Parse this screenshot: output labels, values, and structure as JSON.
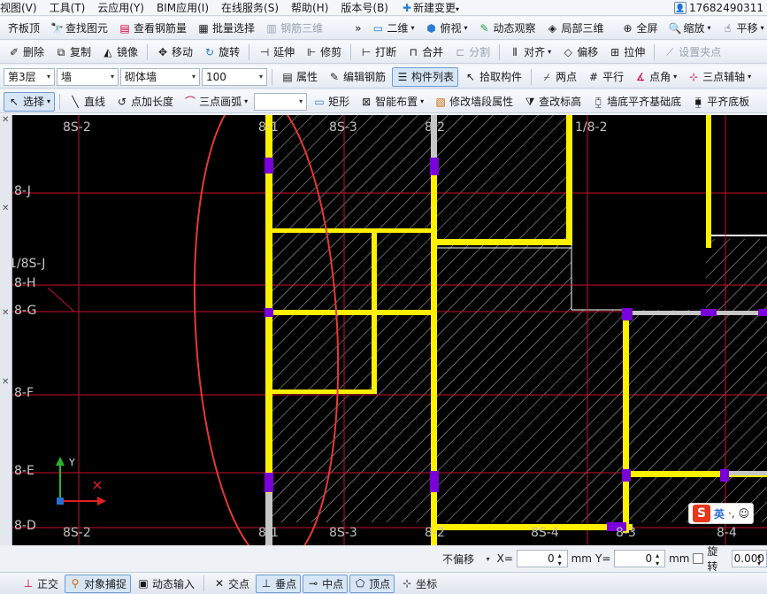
{
  "menu": {
    "items": [
      "视图(V)",
      "工具(T)",
      "云应用(Y)",
      "BIM应用(I)",
      "在线服务(S)",
      "帮助(H)",
      "版本号(B)",
      "新建变更"
    ],
    "user_id": "17682490311"
  },
  "toolbar1": {
    "items": [
      "齐板顶",
      "查找图元",
      "查看钢筋量",
      "批量选择",
      "钢筋三维"
    ],
    "more": "»",
    "view_items": [
      "二维",
      "俯视",
      "动态观察",
      "局部三维",
      "全屏",
      "缩放",
      "平移",
      "屏"
    ]
  },
  "toolbar2": {
    "items": [
      "删除",
      "复制",
      "镜像",
      "移动",
      "旋转",
      "延伸",
      "修剪",
      "打断",
      "合并",
      "分割",
      "对齐",
      "偏移",
      "拉伸",
      "设置夹点"
    ]
  },
  "toolbar3": {
    "floor": "第3层",
    "category": "墙",
    "type": "砌体墙",
    "size": "100",
    "items": [
      "属性",
      "编辑钢筋",
      "构件列表",
      "拾取构件",
      "两点",
      "平行",
      "点角",
      "三点辅轴"
    ]
  },
  "toolbar4": {
    "select": "选择",
    "items": [
      "直线",
      "点加长度",
      "三点画弧",
      "矩形",
      "智能布置",
      "修改墙段属性",
      "查改标高",
      "墙底平齐基础底",
      "平齐底板"
    ]
  },
  "canvas": {
    "top_labels": [
      "8S-2",
      "8-1",
      "8S-3",
      "8-2",
      "1/8-2"
    ],
    "bottom_labels": [
      "8S-2",
      "8-1",
      "8S-3",
      "8-2",
      "8S-4",
      "8-3",
      "8-4"
    ],
    "left_labels": [
      "8-J",
      "1/8S-J",
      "8-H",
      "8-G",
      "8-F",
      "8-E",
      "8-D"
    ],
    "axis_y": "Y",
    "axis_x": "X"
  },
  "ime": {
    "logo": "S",
    "lang": "英",
    "punct": "·,",
    "emoji": "☺"
  },
  "coords": {
    "offset_mode": "不偏移",
    "x_label": "X=",
    "x_value": "0",
    "x_unit": "mm",
    "y_label": "Y=",
    "y_value": "0",
    "y_unit": "mm",
    "rotate_label": "旋转",
    "rotate_value": "0.000"
  },
  "statusbar": {
    "items": [
      "正交",
      "对象捕捉",
      "动态输入",
      "交点",
      "垂点",
      "中点",
      "顶点",
      "坐标"
    ]
  },
  "colors": {
    "wall": "#ffef00",
    "axis": "#c8102e",
    "column": "#7a00d9",
    "annotation": "#e53935"
  }
}
